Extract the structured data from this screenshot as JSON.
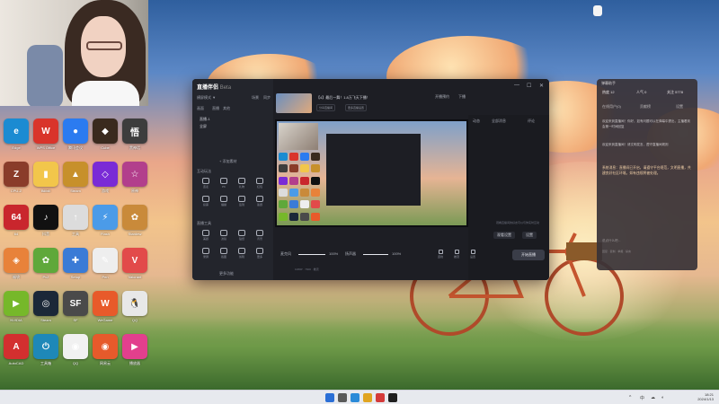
{
  "app": {
    "brand": "直播伴侣",
    "brand_tag": "Beta",
    "scene_label": "横屏模式 ▼",
    "scene_tabs": [
      "场景",
      "同步"
    ],
    "sub_tabs": [
      "画面",
      "直播",
      "其他"
    ],
    "scene_items": [
      "直播-1",
      "全屏"
    ],
    "add_source": "+ 添加素材",
    "section_interact": "互动玩法",
    "section_tools": "直播工具",
    "interact_tools": [
      "连麦",
      "PK",
      "礼物",
      "红包",
      "投票",
      "福袋",
      "签到",
      "答题"
    ],
    "live_tools": [
      "美颜",
      "滤镜",
      "贴纸",
      "背景",
      "录屏",
      "截图",
      "剪辑",
      "更多"
    ],
    "more_link": "更多功能",
    "top_title": "【4】最后一舞！1.8万飞天下播！",
    "top_chips": [
      "分享直播间",
      "更多直播设置"
    ],
    "top_right": [
      "开播预约",
      "下播"
    ],
    "sidebar_tabs": [
      "动态",
      "全部消息",
      "评论"
    ],
    "side_note": "观看直播间的好友可以与你实时互动",
    "side_buttons": [
      "观看设置",
      "设置"
    ],
    "vol_labels": [
      "麦克风",
      "扬声器"
    ],
    "vol_values": [
      "100%",
      "100%"
    ],
    "bottom_icons": [
      "连线",
      "推流",
      "设置"
    ],
    "start_button": "开始直播",
    "mode_chips": [
      "1080P",
      "7600",
      "推流"
    ],
    "window_controls": [
      "—",
      "☐",
      "✕"
    ]
  },
  "right_panel": {
    "title": "弹幕助手",
    "stats": [
      "热度 12",
      "人气 0",
      "关注 5778"
    ],
    "tabs": [
      "在线用户(0)",
      "贡献榜",
      "设置"
    ],
    "text_1": "欢迎来到直播间！你好，如有问题可以在弹幕中提出，主播看到会第一时间回复",
    "text_2": "欢迎来到直播间！请文明发言，遵守直播间规则",
    "notice": "系统消息：直播间已开启，请遵守平台规范，文明直播，共建良好社区环境。如有违规将被处理。",
    "input_placeholder": "说点什么吧...",
    "footer": "回复 · 复制 · 举报 · 禁言"
  },
  "desktop_icons": [
    {
      "label": "Edge",
      "color": "#1b8bd2",
      "glyph": "e"
    },
    {
      "label": "WPS Office",
      "color": "#d9342b",
      "glyph": "W"
    },
    {
      "label": "腾讯会议",
      "color": "#2b7bf0",
      "glyph": "●"
    },
    {
      "label": "Cube",
      "color": "#3a2a1e",
      "glyph": "◆"
    },
    {
      "label": "黑神话",
      "color": "#3d3d3d",
      "glyph": "悟"
    },
    {
      "label": "CPU-Z",
      "color": "#8a3c2a",
      "glyph": "Z"
    },
    {
      "label": "Bilibili",
      "color": "#f2c64b",
      "glyph": "▮"
    },
    {
      "label": "Steam",
      "color": "#c7902b",
      "glyph": "▲"
    },
    {
      "label": "游戏",
      "color": "#7a2bd6",
      "glyph": "◇"
    },
    {
      "label": "原神",
      "color": "#b23f8c",
      "glyph": "☆"
    },
    {
      "label": "64",
      "color": "#c9262d",
      "glyph": "64"
    },
    {
      "label": "抖音",
      "color": "#111111",
      "glyph": "♪"
    },
    {
      "label": "工具",
      "color": "#dcdcdc",
      "glyph": "↑"
    },
    {
      "label": "Flash",
      "color": "#4b9be8",
      "glyph": "⚡"
    },
    {
      "label": "Stardew",
      "color": "#c98a3a",
      "glyph": "✿"
    },
    {
      "label": "福袋",
      "color": "#e8823a",
      "glyph": "◈"
    },
    {
      "label": "PvZ",
      "color": "#5fa83a",
      "glyph": "✿"
    },
    {
      "label": "Setup",
      "color": "#3a7bd6",
      "glyph": "✚"
    },
    {
      "label": "Pen",
      "color": "#eeeeee",
      "glyph": "✎"
    },
    {
      "label": "Valorant",
      "color": "#e24a4a",
      "glyph": "V"
    },
    {
      "label": "NVIDIA",
      "color": "#76b82a",
      "glyph": "▶"
    },
    {
      "label": "Steam",
      "color": "#1b2838",
      "glyph": "◎"
    },
    {
      "label": "SF",
      "color": "#4a4a4a",
      "glyph": "SF"
    },
    {
      "label": "WeGame",
      "color": "#e85a2a",
      "glyph": "W"
    },
    {
      "label": "QQ",
      "color": "#e8e8e8",
      "glyph": "🐧"
    },
    {
      "label": "AutoCAD",
      "color": "#d32f2f",
      "glyph": "A"
    },
    {
      "label": "工具箱",
      "color": "#1e88b8",
      "glyph": "⏻"
    },
    {
      "label": "QQ",
      "color": "#f1f1f1",
      "glyph": "◉"
    },
    {
      "label": "网易云",
      "color": "#e65a2b",
      "glyph": "◉"
    },
    {
      "label": "播放器",
      "color": "#e23f8d",
      "glyph": "▶"
    }
  ],
  "taskbar": {
    "time": "18:21",
    "date": "2024/1/13",
    "tray": [
      "^",
      "中",
      "☁",
      "◐"
    ]
  }
}
